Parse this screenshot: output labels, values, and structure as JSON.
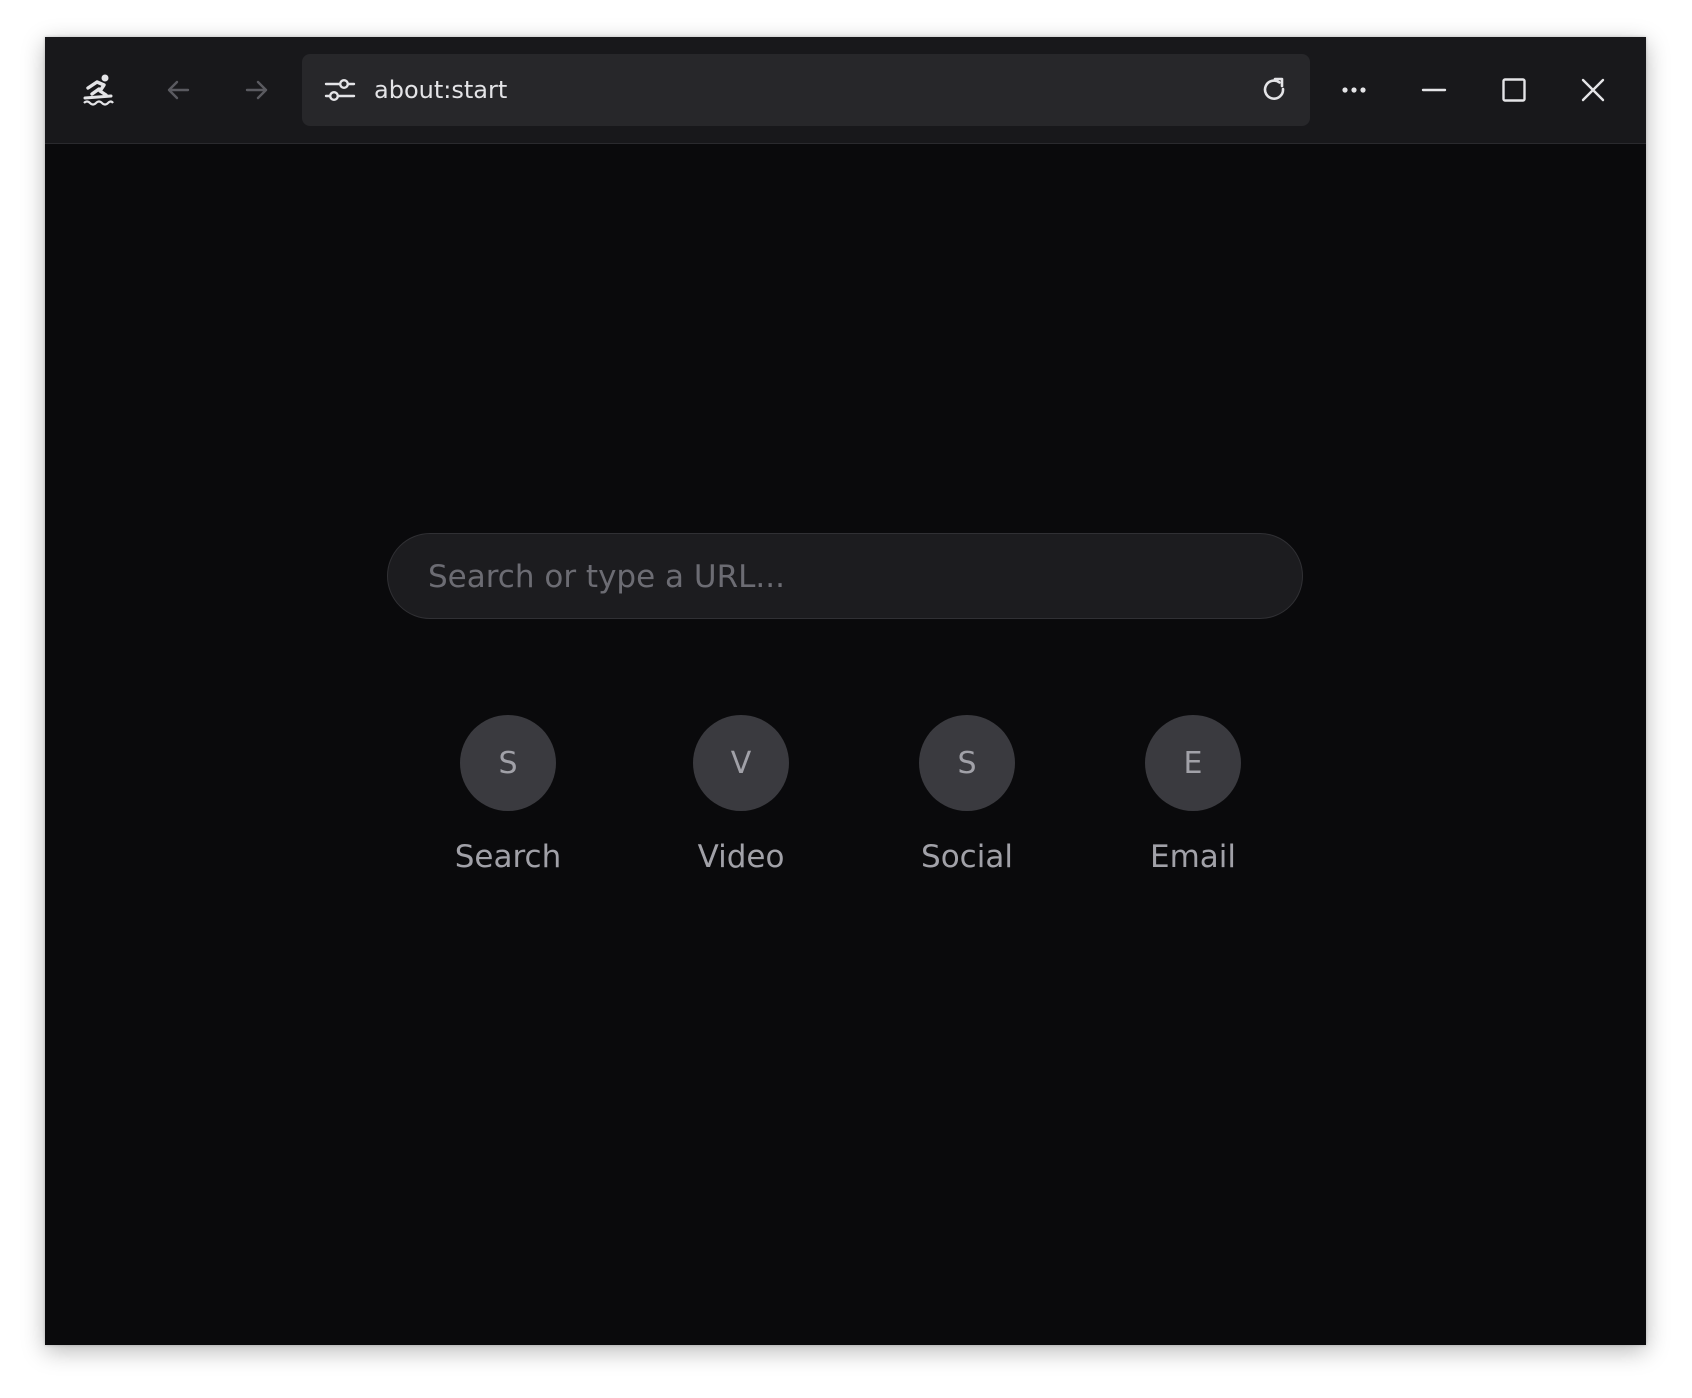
{
  "titlebar": {
    "app_icon": "surfer-icon",
    "back_icon": "arrow-left-icon",
    "forward_icon": "arrow-right-icon",
    "url": "about:start",
    "tune_icon": "sliders-icon",
    "reload_icon": "reload-icon",
    "menu_icon": "more-horizontal-icon",
    "minimize_icon": "minimize-icon",
    "maximize_icon": "maximize-icon",
    "close_icon": "close-icon"
  },
  "start": {
    "search_placeholder": "Search or type a URL...",
    "shortcuts": [
      {
        "initial": "S",
        "label": "Search"
      },
      {
        "initial": "V",
        "label": "Video"
      },
      {
        "initial": "S",
        "label": "Social"
      },
      {
        "initial": "E",
        "label": "Email"
      }
    ]
  },
  "colors": {
    "titlebar_bg": "#18181b",
    "urlbar_bg": "#27272a",
    "content_bg": "#0a0a0c",
    "search_bg": "#1c1c1f",
    "shortcut_circle": "#3a3a3f",
    "muted_text": "#a1a1a8",
    "placeholder_text": "#6c6c73"
  }
}
